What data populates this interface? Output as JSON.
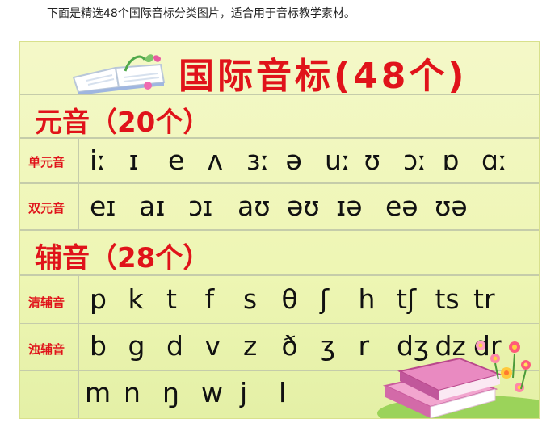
{
  "caption": "下面是精选48个国际音标分类图片，适合用于音标教学素材。",
  "poster": {
    "title": "国际音标(48个)",
    "vowels_header": "元音（20个）",
    "consonants_header": "辅音（28个）",
    "rows": {
      "monophthongs": {
        "label": "单元音",
        "symbols": [
          "iː",
          "ɪ",
          "e",
          "ʌ",
          "ɜː",
          "ə",
          "uː",
          "ʊ",
          "ɔː",
          "ɒ",
          "ɑː"
        ]
      },
      "diphthongs": {
        "label": "双元音",
        "symbols": [
          "eɪ",
          "aɪ",
          "ɔɪ",
          "aʊ",
          "əʊ",
          "ɪə",
          "eə",
          "ʊə"
        ]
      },
      "voiceless": {
        "label": "清辅音",
        "symbols": [
          "p",
          "k",
          "t",
          "f",
          "s",
          "θ",
          "ʃ",
          "h",
          "tʃ",
          "ts",
          "tr"
        ]
      },
      "voiced": {
        "label": "浊辅音",
        "symbols": [
          "b",
          "g",
          "d",
          "v",
          "z",
          "ð",
          "ʒ",
          "r",
          "dʒ",
          "dz",
          "dr"
        ]
      },
      "other": {
        "label": "",
        "symbols": [
          "m",
          "n",
          "ŋ",
          "w",
          "j",
          "l"
        ]
      }
    }
  },
  "colors": {
    "accent_red": "#e0131a",
    "poster_bg": "#f1f7bf",
    "grid_line": "#c5ccaa"
  },
  "icons": {
    "title_decoration": "open-book-icon",
    "corner_decoration": "books-and-flowers-icon"
  }
}
